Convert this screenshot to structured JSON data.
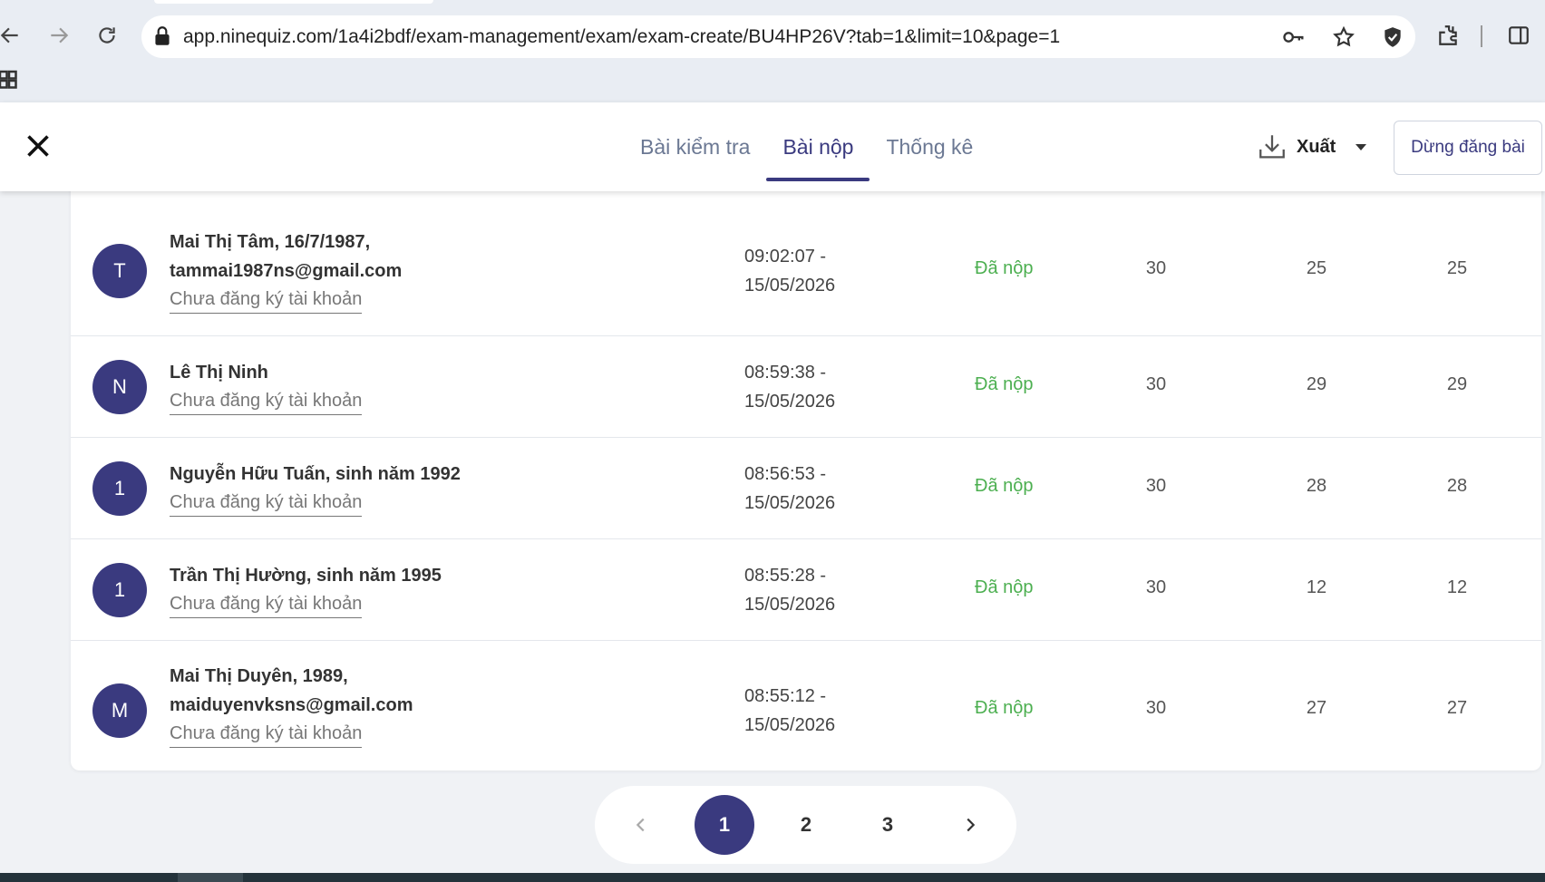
{
  "browser": {
    "url": "app.ninequiz.com/1a4i2bdf/exam-management/exam/exam-create/BU4HP26V?tab=1&limit=10&page=1"
  },
  "header": {
    "tabs": [
      {
        "label": "Bài kiểm tra",
        "active": false
      },
      {
        "label": "Bài nộp",
        "active": true
      },
      {
        "label": "Thống kê",
        "active": false
      }
    ],
    "export_label": "Xuất",
    "stop_label": "Dừng đăng bài"
  },
  "submissions": [
    {
      "initial": "T",
      "name_line1": "Mai Thị Tâm, 16/7/1987,",
      "name_line2": "tammai1987ns@gmail.com",
      "account": "Chưa đăng ký tài khoản",
      "time": "09:02:07 -",
      "date": "15/05/2026",
      "status": "Đã nộp",
      "total": "30",
      "correct": "25",
      "score": "25"
    },
    {
      "initial": "N",
      "name_line1": "Lê Thị Ninh",
      "name_line2": "",
      "account": "Chưa đăng ký tài khoản",
      "time": "08:59:38 -",
      "date": "15/05/2026",
      "status": "Đã nộp",
      "total": "30",
      "correct": "29",
      "score": "29"
    },
    {
      "initial": "1",
      "name_line1": "Nguyễn Hữu Tuấn, sinh năm 1992",
      "name_line2": "",
      "account": "Chưa đăng ký tài khoản",
      "time": "08:56:53 -",
      "date": "15/05/2026",
      "status": "Đã nộp",
      "total": "30",
      "correct": "28",
      "score": "28"
    },
    {
      "initial": "1",
      "name_line1": "Trần Thị Hường, sinh năm 1995",
      "name_line2": "",
      "account": "Chưa đăng ký tài khoản",
      "time": "08:55:28 -",
      "date": "15/05/2026",
      "status": "Đã nộp",
      "total": "30",
      "correct": "12",
      "score": "12"
    },
    {
      "initial": "M",
      "name_line1": "Mai Thị Duyên, 1989,",
      "name_line2": "maiduyenvksns@gmail.com",
      "account": "Chưa đăng ký tài khoản",
      "time": "08:55:12 -",
      "date": "15/05/2026",
      "status": "Đã nộp",
      "total": "30",
      "correct": "27",
      "score": "27"
    }
  ],
  "pagination": {
    "pages": [
      "1",
      "2",
      "3"
    ],
    "current": "1"
  },
  "colors": {
    "accent": "#3a3a7f",
    "status_submitted": "#4caf50"
  }
}
